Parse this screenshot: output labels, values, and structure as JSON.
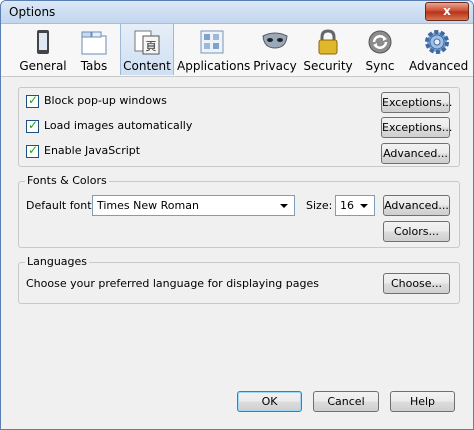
{
  "window": {
    "title": "Options",
    "close_glyph": "x"
  },
  "tabs": [
    {
      "label": "General",
      "icon": "general-icon"
    },
    {
      "label": "Tabs",
      "icon": "tabs-icon"
    },
    {
      "label": "Content",
      "icon": "content-icon",
      "selected": true
    },
    {
      "label": "Applications",
      "icon": "applications-icon"
    },
    {
      "label": "Privacy",
      "icon": "privacy-icon"
    },
    {
      "label": "Security",
      "icon": "security-icon"
    },
    {
      "label": "Sync",
      "icon": "sync-icon"
    },
    {
      "label": "Advanced",
      "icon": "advanced-icon"
    }
  ],
  "content_options": {
    "block_popups": {
      "label": "Block pop-up windows",
      "checked": true,
      "button": "Exceptions..."
    },
    "load_images": {
      "label": "Load images automatically",
      "checked": true,
      "button": "Exceptions..."
    },
    "enable_js": {
      "label": "Enable JavaScript",
      "checked": true,
      "button": "Advanced..."
    }
  },
  "fonts": {
    "group_title": "Fonts & Colors",
    "default_font_label": "Default font:",
    "default_font_value": "Times New Roman",
    "size_label": "Size:",
    "size_value": "16",
    "advanced_button": "Advanced...",
    "colors_button": "Colors..."
  },
  "languages": {
    "group_title": "Languages",
    "description": "Choose your preferred language for displaying pages",
    "choose_button": "Choose..."
  },
  "footer": {
    "ok": "OK",
    "cancel": "Cancel",
    "help": "Help"
  },
  "colors": {
    "accent": "#3c7fb1",
    "check": "#21a121",
    "close": "#c7452b"
  }
}
